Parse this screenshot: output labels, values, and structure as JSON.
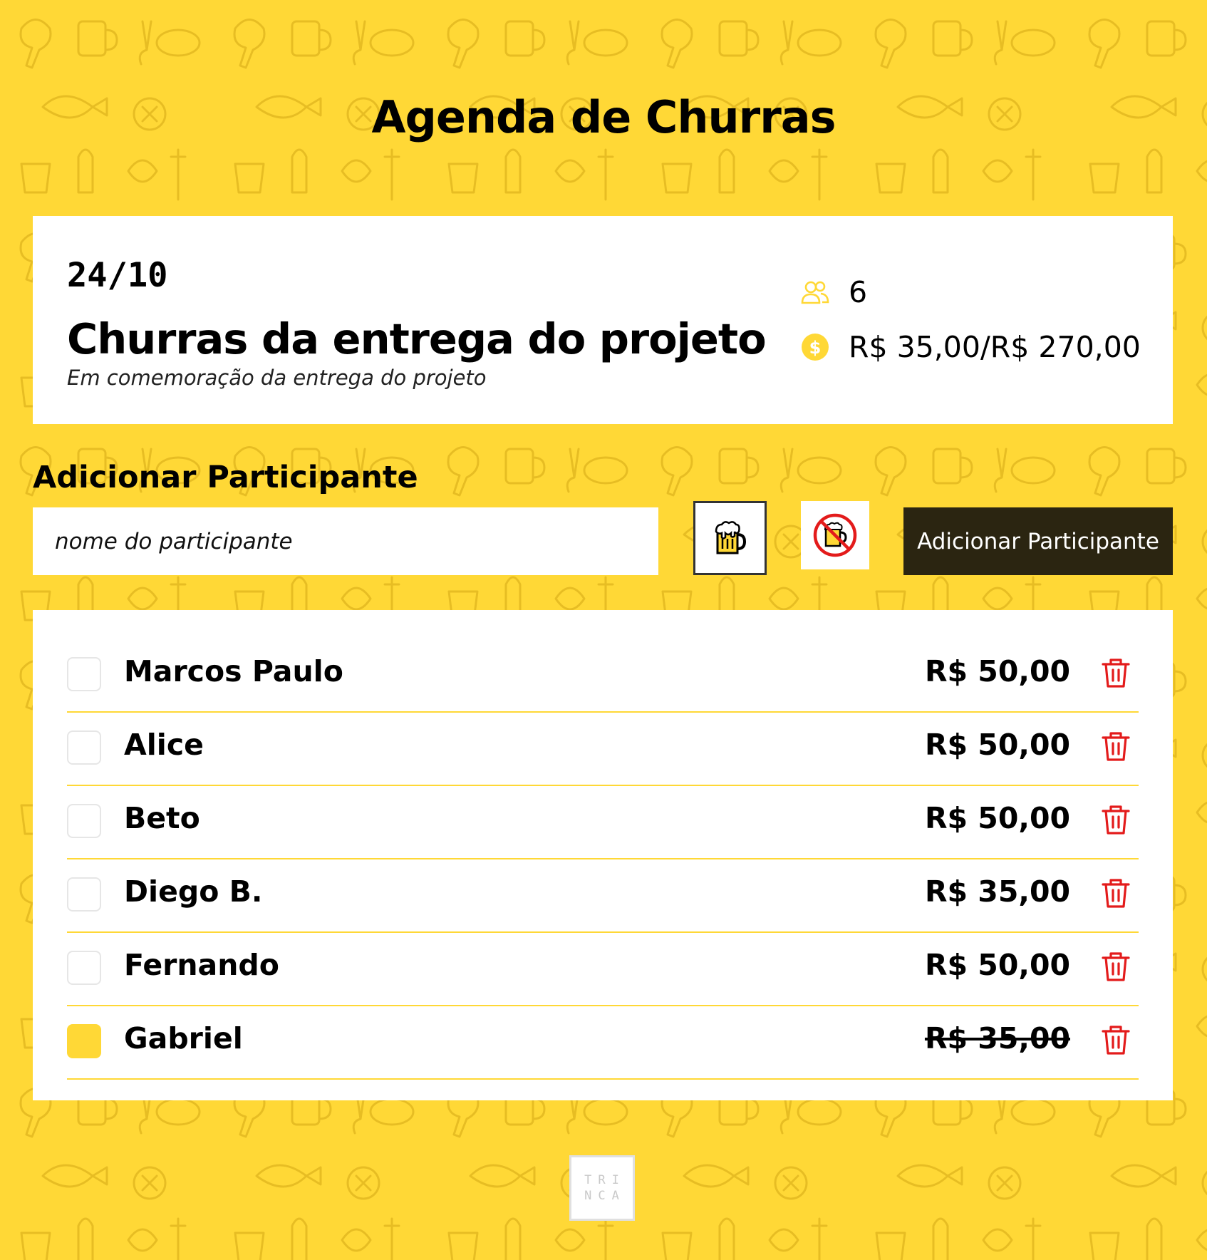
{
  "app": {
    "title": "Agenda de Churras"
  },
  "event": {
    "date": "24/10",
    "name": "Churras da entrega do projeto",
    "description": "Em comemoração da entrega do projeto",
    "participant_count": "6",
    "money": "R$ 35,00/R$ 270,00",
    "people_icon": "people-icon",
    "money_icon": "coin-icon"
  },
  "add_form": {
    "title": "Adicionar Participante",
    "name_placeholder": "nome do participante",
    "with_drink_icon": "beer-mug-icon",
    "without_drink_icon": "no-beer-icon",
    "submit_label": "Adicionar Participante"
  },
  "participants": [
    {
      "name": "Marcos Paulo",
      "value": "R$ 50,00",
      "paid": false
    },
    {
      "name": "Alice",
      "value": "R$ 50,00",
      "paid": false
    },
    {
      "name": "Beto",
      "value": "R$ 50,00",
      "paid": false
    },
    {
      "name": "Diego B.",
      "value": "R$ 35,00",
      "paid": false
    },
    {
      "name": "Fernando",
      "value": "R$ 50,00",
      "paid": false
    },
    {
      "name": "Gabriel",
      "value": "R$ 35,00",
      "paid": true
    }
  ],
  "footer": {
    "logo_line1": "TRI",
    "logo_line2": "NCA"
  },
  "colors": {
    "background": "#FFD836",
    "accent": "#FFD836",
    "button_dark": "#2B2511",
    "delete": "#E31B1B"
  }
}
